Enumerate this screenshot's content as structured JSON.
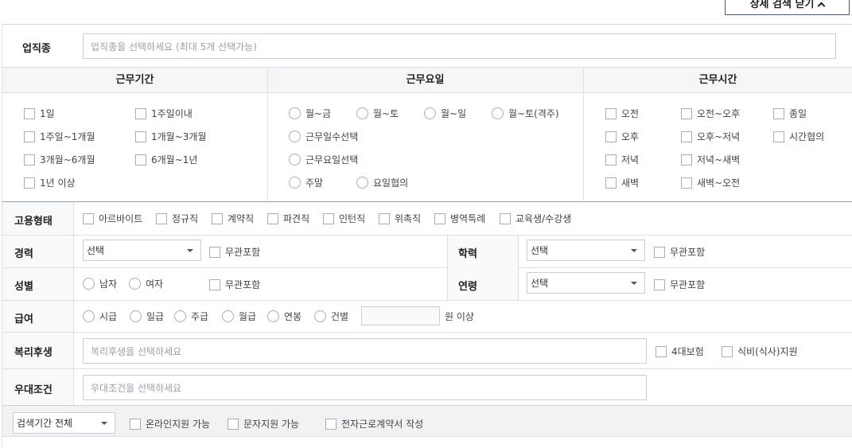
{
  "close_label": "상세 검색 닫기",
  "job": {
    "label": "업직종",
    "placeholder": "업직종을 선택하세요 (최대 5개 선택가능)"
  },
  "headers": {
    "period": "근무기간",
    "days": "근무요일",
    "time": "근무시간"
  },
  "period": [
    "1일",
    "1주일이내",
    "1주일~1개월",
    "1개월~3개월",
    "3개월~6개월",
    "6개월~1년",
    "1년 이상"
  ],
  "days": [
    "월~금",
    "월~토",
    "월~일",
    "월~토(격주)",
    "근무일수선택",
    "근무요일선택",
    "주말",
    "요일협의"
  ],
  "time": [
    "오전",
    "오전~오후",
    "종일",
    "오후",
    "오후~저녁",
    "시간협의",
    "저녁",
    "저녁~새벽",
    "새벽",
    "새벽~오전"
  ],
  "employment": {
    "label": "고용형태",
    "options": [
      "아르바이트",
      "정규직",
      "계약직",
      "파견직",
      "인턴직",
      "위촉직",
      "병역특례",
      "교육생/수강생"
    ]
  },
  "career": {
    "label": "경력",
    "select": "선택",
    "any": "무관포함"
  },
  "education": {
    "label": "학력",
    "select": "선택",
    "any": "무관포함"
  },
  "gender": {
    "label": "성별",
    "options": [
      "남자",
      "여자"
    ],
    "any": "무관포함"
  },
  "age": {
    "label": "연령",
    "select": "선택",
    "any": "무관포함"
  },
  "pay": {
    "label": "급여",
    "options": [
      "시급",
      "일급",
      "주급",
      "월급",
      "연봉",
      "건별"
    ],
    "suffix": "원 이상"
  },
  "welfare": {
    "label": "복리후생",
    "placeholder": "복리후생을 선택하세요",
    "options": [
      "4대보험",
      "식비(식사)지원"
    ]
  },
  "preference": {
    "label": "우대조건",
    "placeholder": "우대조건을 선택하세요"
  },
  "bottom": {
    "period_select": "검색기간 전체",
    "options": [
      "온라인지원 가능",
      "문자지원 가능",
      "전자근로계약서 작성"
    ]
  }
}
